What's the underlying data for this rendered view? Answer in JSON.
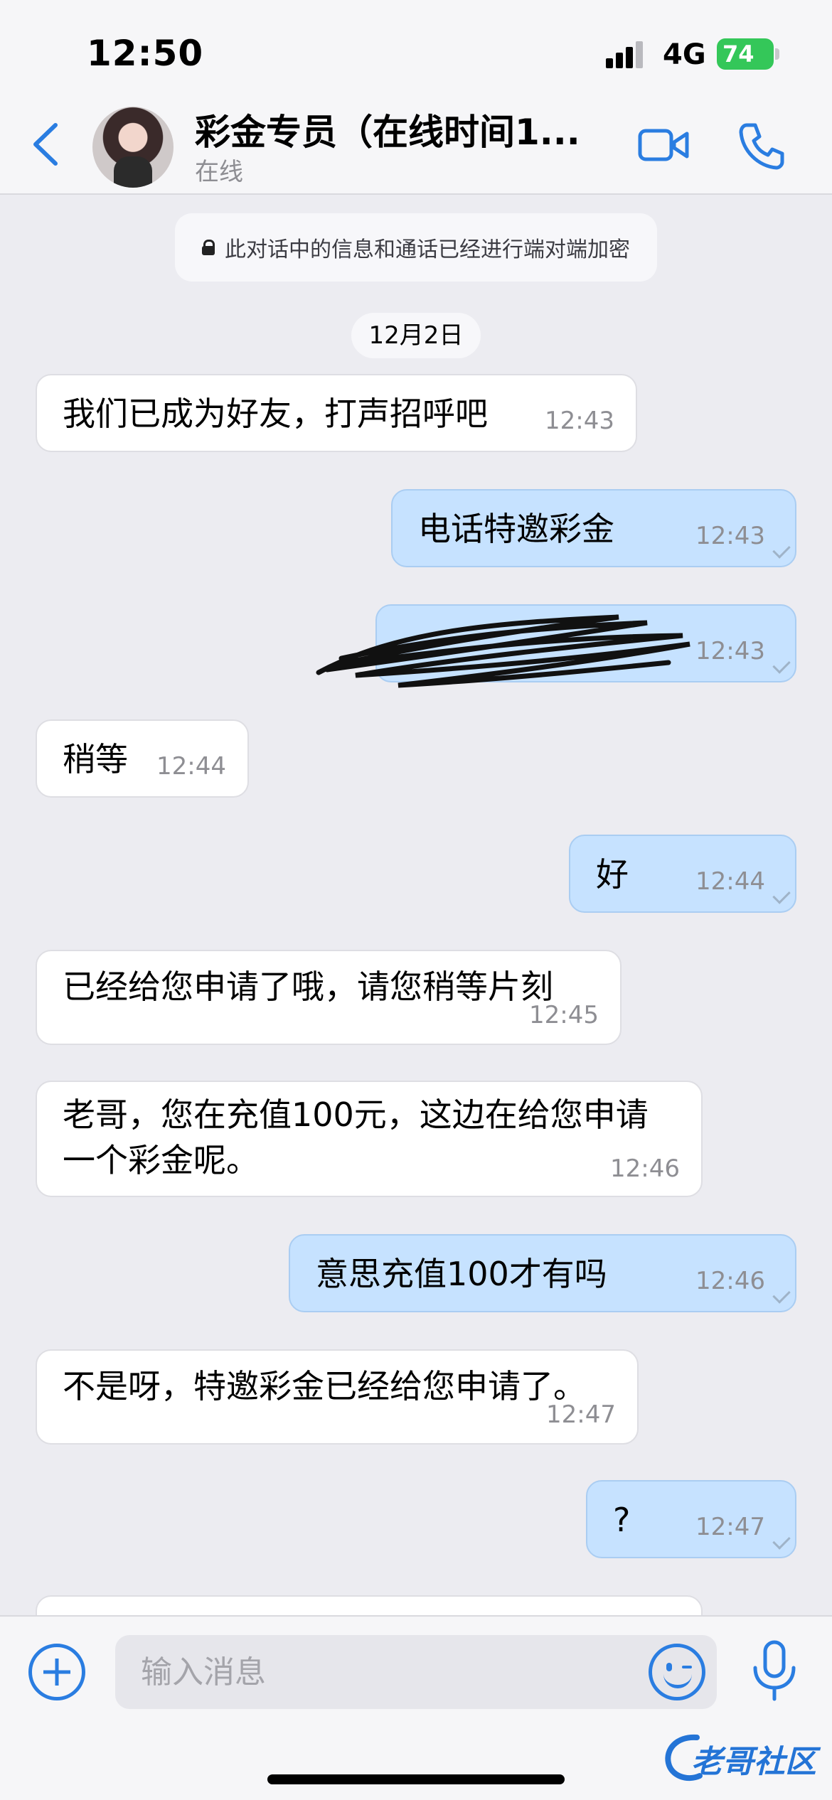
{
  "status_bar": {
    "time": "12:50",
    "network": "4G",
    "battery": "74"
  },
  "header": {
    "title": "彩金专员（在线时间1...",
    "status": "在线"
  },
  "encryption_notice": "此对话中的信息和通话已经进行端对端加密",
  "date_divider": "12月2日",
  "messages": [
    {
      "dir": "in",
      "text": "我们已成为好友，打声招呼吧",
      "time": "12:43"
    },
    {
      "dir": "out",
      "text": "电话特邀彩金",
      "time": "12:43"
    },
    {
      "dir": "out",
      "text": "",
      "time": "12:43"
    },
    {
      "dir": "in",
      "text": "稍等",
      "time": "12:44"
    },
    {
      "dir": "out",
      "text": "好",
      "time": "12:44"
    },
    {
      "dir": "in",
      "text": "已经给您申请了哦，请您稍等片刻",
      "time": "12:45"
    },
    {
      "dir": "in",
      "text": "老哥，您在充值100元，这边在给您申请一个彩金呢。",
      "time": "12:46"
    },
    {
      "dir": "out",
      "text": "意思充值100才有吗",
      "time": "12:46"
    },
    {
      "dir": "in",
      "text": "不是呀，特邀彩金已经给您申请了。",
      "time": "12:47"
    },
    {
      "dir": "out",
      "text": "?",
      "time": "12:47"
    }
  ],
  "input": {
    "placeholder": "输入消息"
  },
  "watermark": "老哥社区",
  "colors": {
    "accent": "#2a7de1",
    "outgoing_bubble": "#c6e2ff",
    "incoming_bubble": "#ffffff",
    "battery": "#34c759"
  }
}
